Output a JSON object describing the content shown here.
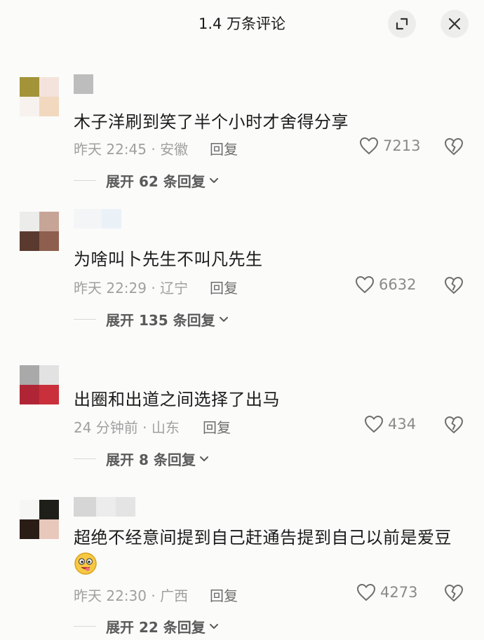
{
  "header": {
    "title": "1.4 万条评论"
  },
  "colors": {
    "icon": "#6e6e6e",
    "meta": "#a0a0a0",
    "text": "#1b1b1b"
  },
  "comments": [
    {
      "text": "木子洋刷到笑了半个小时才舍得分享",
      "time_loc": "昨天 22:45 · 安徽",
      "reply": "回复",
      "likes": "7213",
      "expand": "展开 62 条回复"
    },
    {
      "text": "为啥叫卜先生不叫凡先生",
      "time_loc": "昨天 22:29 · 辽宁",
      "reply": "回复",
      "likes": "6632",
      "expand": "展开 135 条回复"
    },
    {
      "text": "出圈和出道之间选择了出马",
      "time_loc": "24 分钟前 · 山东",
      "reply": "回复",
      "likes": "434",
      "expand": "展开 8 条回复"
    },
    {
      "text": "超绝不经意间提到自己赶通告提到自己以前是爱豆",
      "time_loc": "昨天 22:30 · 广西",
      "reply": "回复",
      "likes": "4273",
      "expand": "展开 22 条回复"
    }
  ]
}
